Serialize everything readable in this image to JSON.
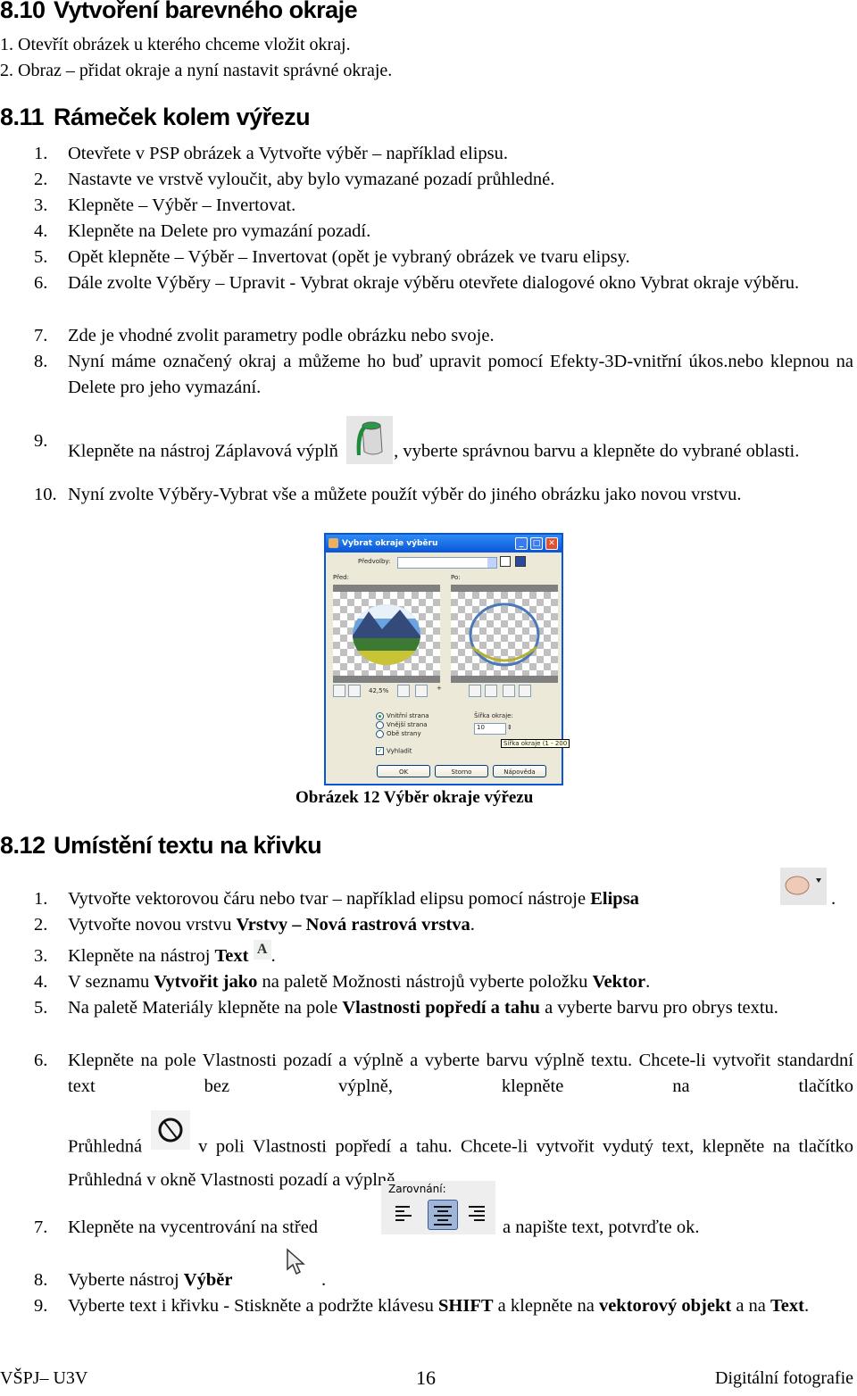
{
  "sections": {
    "s810": {
      "num": "8.10",
      "title": "Vytvoření barevného okraje",
      "items": [
        "1. Otevřít obrázek u kterého chceme vložit okraj.",
        "2. Obraz – přidat okraje a nyní nastavit správné okraje."
      ]
    },
    "s811": {
      "num": "8.11",
      "title": "Rámeček kolem výřezu",
      "items": [
        {
          "n": "1.",
          "t": "Otevřete v PSP obrázek a Vytvořte výběr – například elipsu."
        },
        {
          "n": "2.",
          "t": "Nastavte ve vrstvě vyloučit, aby bylo vymazané pozadí průhledné."
        },
        {
          "n": "3.",
          "t": "Klepněte – Výběr – Invertovat."
        },
        {
          "n": "4.",
          "t": "Klepněte na Delete pro vymazání pozadí."
        },
        {
          "n": "5.",
          "t": "Opět klepněte – Výběr – Invertovat (opět je vybraný obrázek ve tvaru elipsy."
        },
        {
          "n": "6.",
          "t": "Dále zvolte Výběry – Upravit - Vybrat okraje výběru otevřete dialogové okno Vybrat okraje výběru."
        },
        {
          "n": "7.",
          "t": "Zde je vhodné zvolit parametry podle obrázku nebo svoje."
        },
        {
          "n": "8.",
          "t": "Nyní máme označený okraj a můžeme ho buď upravit pomocí Efekty-3D-vnitřní úkos.nebo klepnou na Delete pro jeho vymazání."
        },
        {
          "n": "9.",
          "t1": "Klepněte na nástroj Záplavová výplň",
          "t2": ", vyberte správnou barvu a klepněte do vybrané oblasti."
        },
        {
          "n": "10.",
          "t": "Nyní zvolte Výběry-Vybrat vše a můžete použít výběr do jiného obrázku jako novou vrstvu."
        }
      ]
    },
    "dialog": {
      "title": "Vybrat okraje výběru",
      "presets_label": "Předvolby:",
      "presets_value": "",
      "before_label": "Před:",
      "after_label": "Po:",
      "zoom": "42,5%",
      "radio_options": [
        "Vnitřní strana",
        "Vnější strana",
        "Obě strany"
      ],
      "radio_selected": 0,
      "width_label": "Šířka okraje:",
      "width_value": "10",
      "width_tooltip": "Šířka okraje (1 - 200",
      "smooth_label": "Vyhladit",
      "smooth_checked": true,
      "buttons": {
        "ok": "OK",
        "cancel": "Storno",
        "help": "Nápověda"
      }
    },
    "caption": "Obrázek 12 Výběr okraje výřezu",
    "s812": {
      "num": "8.12",
      "title": "Umístění textu na křivku",
      "i1a": "Vytvořte vektorovou čáru nebo tvar – například elipsu pomocí nástroje ",
      "i1b": "Elipsa",
      "i2a": "Vytvořte novou vrstvu ",
      "i2b": "Vrstvy – Nová rastrová vrstva",
      "i3a": "Klepněte na nástroj ",
      "i3b": "Text",
      "i4a": "V seznamu ",
      "i4b": "Vytvořit jako",
      "i4c": " na paletě Možnosti nástrojů vyberte položku ",
      "i4d": "Vektor",
      "i5a": "Na paletě Materiály klepněte na pole ",
      "i5b": "Vlastnosti popředí a tahu",
      "i5c": " a vyberte barvu pro obrys textu.",
      "i6a": "Klepněte na pole Vlastnosti pozadí a výplně a vyberte barvu výplně textu. Chcete-li vytvořit standardní text bez výplně, klepněte na tlačítko",
      "i6b": "Průhledná",
      "i6c": "v poli Vlastnosti popředí a tahu. Chcete-li vytvořit vydutý text, klepněte na tlačítko Průhledná v okně Vlastnosti pozadí a výplně.",
      "i7a": "Klepněte na vycentrování na střed",
      "i7b": "a napište text, potvrďte ok.",
      "align_label": "Zarovnání:",
      "i8a": "Vyberte nástroj ",
      "i8b": "Výběr",
      "i9a": "Vyberte text i křivku - Stiskněte a podržte klávesu ",
      "i9b": "SHIFT",
      "i9c": " a klepněte na ",
      "i9d": "vektorový objekt",
      "i9e": " a na ",
      "i9f": "Text",
      "nums": [
        "1.",
        "2.",
        "3.",
        "4.",
        "5.",
        "6.",
        "7.",
        "8.",
        "9."
      ]
    }
  },
  "footer": {
    "left": "VŠPJ– U3V",
    "center": "16",
    "right": "Digitální fotografie"
  }
}
